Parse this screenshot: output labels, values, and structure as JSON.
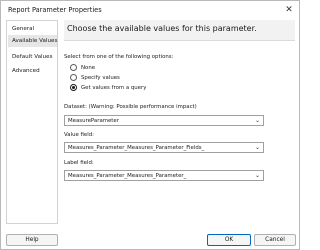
{
  "window": {
    "title": "Report Parameter Properties"
  },
  "nav": {
    "items": [
      {
        "label": "General",
        "selected": false
      },
      {
        "label": "Available Values",
        "selected": true
      },
      {
        "label": "Default Values",
        "selected": false
      },
      {
        "label": "Advanced",
        "selected": false
      }
    ]
  },
  "pane": {
    "header": "Choose the available values for this parameter.",
    "options_label": "Select from one of the following options:",
    "options": [
      {
        "label": "None",
        "checked": false
      },
      {
        "label": "Specify values",
        "checked": false
      },
      {
        "label": "Get values from a query",
        "checked": true
      }
    ],
    "dataset": {
      "label": "Dataset: (Warning: Possible performance impact)",
      "value": "MeasureParameter"
    },
    "value_field": {
      "label": "Value field:",
      "value": "Measures_Parameter_Measures_Parameter_Fields_"
    },
    "label_field": {
      "label": "Label field:",
      "value": "Measures_Parameter_Measures_Parameter_"
    }
  },
  "footer": {
    "help": "Help",
    "ok": "OK",
    "cancel": "Cancel"
  }
}
